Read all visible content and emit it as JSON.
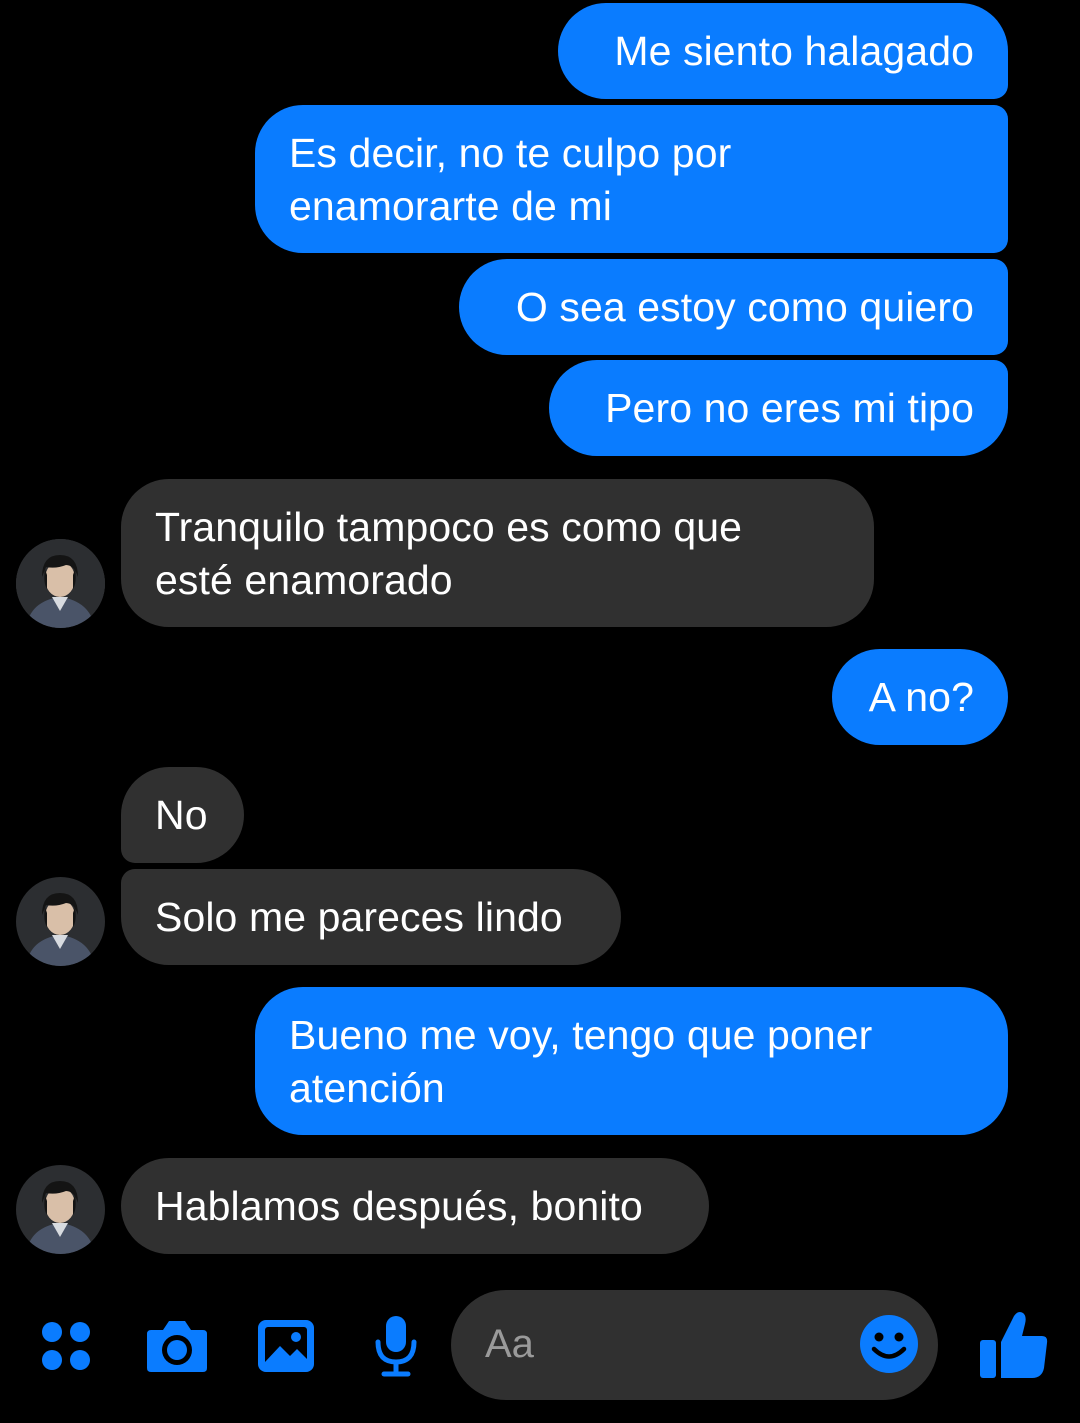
{
  "colors": {
    "background": "#000000",
    "sent_bubble": "#0a7cff",
    "received_bubble": "#303030",
    "accent": "#0a7cff",
    "text": "#ffffff",
    "placeholder": "#9a9a9a"
  },
  "messages": [
    {
      "from": "me",
      "text": "Me siento halagado"
    },
    {
      "from": "me",
      "line1": "Es decir, no te culpo por",
      "line2": "enamorarte de mi"
    },
    {
      "from": "me",
      "text": "O sea estoy como quiero"
    },
    {
      "from": "me",
      "text": "Pero no eres mi tipo"
    },
    {
      "from": "contact",
      "line1": "Tranquilo tampoco es como que",
      "line2": "esté enamorado"
    },
    {
      "from": "me",
      "text": "A no?"
    },
    {
      "from": "contact",
      "text": "No"
    },
    {
      "from": "contact",
      "text": "Solo me pareces lindo"
    },
    {
      "from": "me",
      "line1": "Bueno me voy, tengo que poner",
      "line2": "atención"
    },
    {
      "from": "contact",
      "text": "Hablamos después, bonito"
    }
  ],
  "composer": {
    "placeholder": "Aa",
    "icons": [
      "menu-dots-icon",
      "camera-icon",
      "image-icon",
      "microphone-icon",
      "emoji-icon",
      "thumbs-up-icon"
    ]
  }
}
